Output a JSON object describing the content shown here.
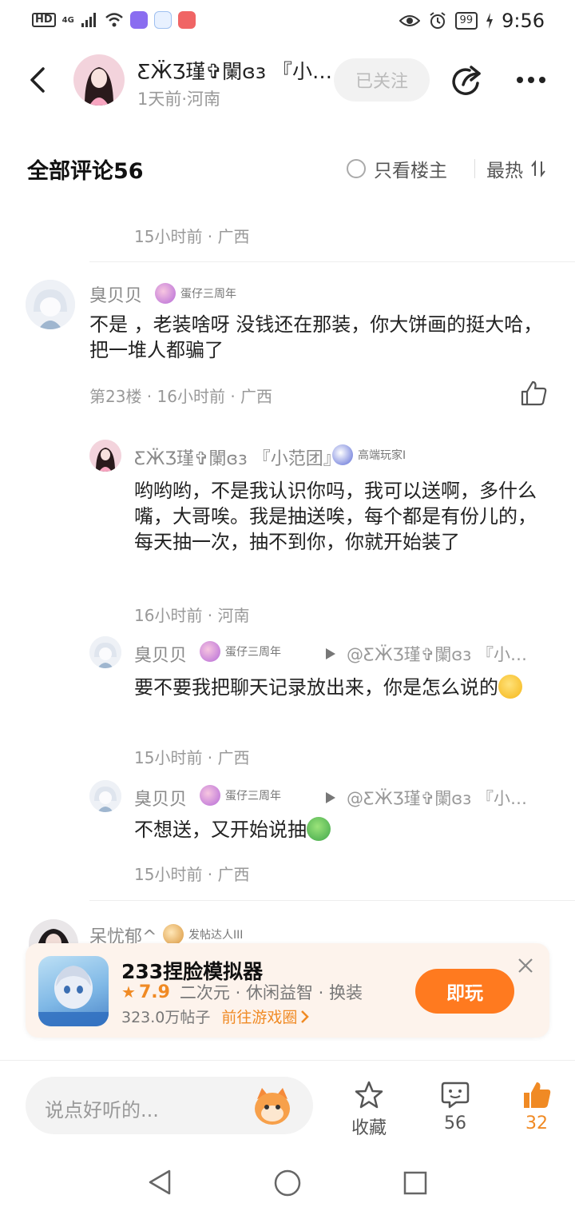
{
  "status_bar": {
    "hd": "HD",
    "network": "4G",
    "battery": "99",
    "time": "9:56"
  },
  "header": {
    "author_name": "ƸӜƷ瑾✞闌ɞɜ 『小范…",
    "meta": "1天前·河南",
    "follow_label": "已关注"
  },
  "comments_header": {
    "title": "全部评论56",
    "owner_only_label": "只看楼主",
    "sort_label": "最热"
  },
  "prev_comment": {
    "time": "15小时前 · 广西"
  },
  "comment_23": {
    "username": "臭贝贝",
    "badge": "蛋仔三周年",
    "text": "不是 ，老装啥呀 没钱还在那装，你大饼画的挺大哈，把一堆人都骗了",
    "meta": "第23楼 · 16小时前 · 广西",
    "replies": [
      {
        "username": "ƸӜƷ瑾✞闌ɞɜ 『小范团』",
        "badge": "高端玩家I",
        "text": "哟哟哟，不是我认识你吗，我可以送啊，多什么嘴，大哥唉。我是抽送唉，每个都是有份儿的，每天抽一次，抽不到你，你就开始装了",
        "meta": "16小时前 · 河南"
      },
      {
        "username": "臭贝贝",
        "badge": "蛋仔三周年",
        "reply_to": "@ƸӜƷ瑾✞闌ɞɜ 『小…",
        "text": "要不要我把聊天记录放出来，你是怎么说的",
        "meta": "15小时前 · 广西"
      },
      {
        "username": "臭贝贝",
        "badge": "蛋仔三周年",
        "reply_to": "@ƸӜƷ瑾✞闌ɞɜ 『小…",
        "text": "不想送，又开始说抽",
        "meta": "15小时前 · 广西"
      }
    ]
  },
  "next_comment": {
    "username": "呆忧郁^",
    "badge": "发帖达人III"
  },
  "ad": {
    "title": "233捏脸模拟器",
    "rating": "7.9",
    "tags": "二次元 · 休闲益智 · 换装",
    "posts": "323.0万帖子",
    "link": "前往游戏圈",
    "play_label": "即玩"
  },
  "bottom_bar": {
    "placeholder": "说点好听的...",
    "favorite_label": "收藏",
    "comment_count": "56",
    "like_count": "32"
  },
  "colors": {
    "accent": "#ff7a1f",
    "like_active": "#f08a24"
  }
}
